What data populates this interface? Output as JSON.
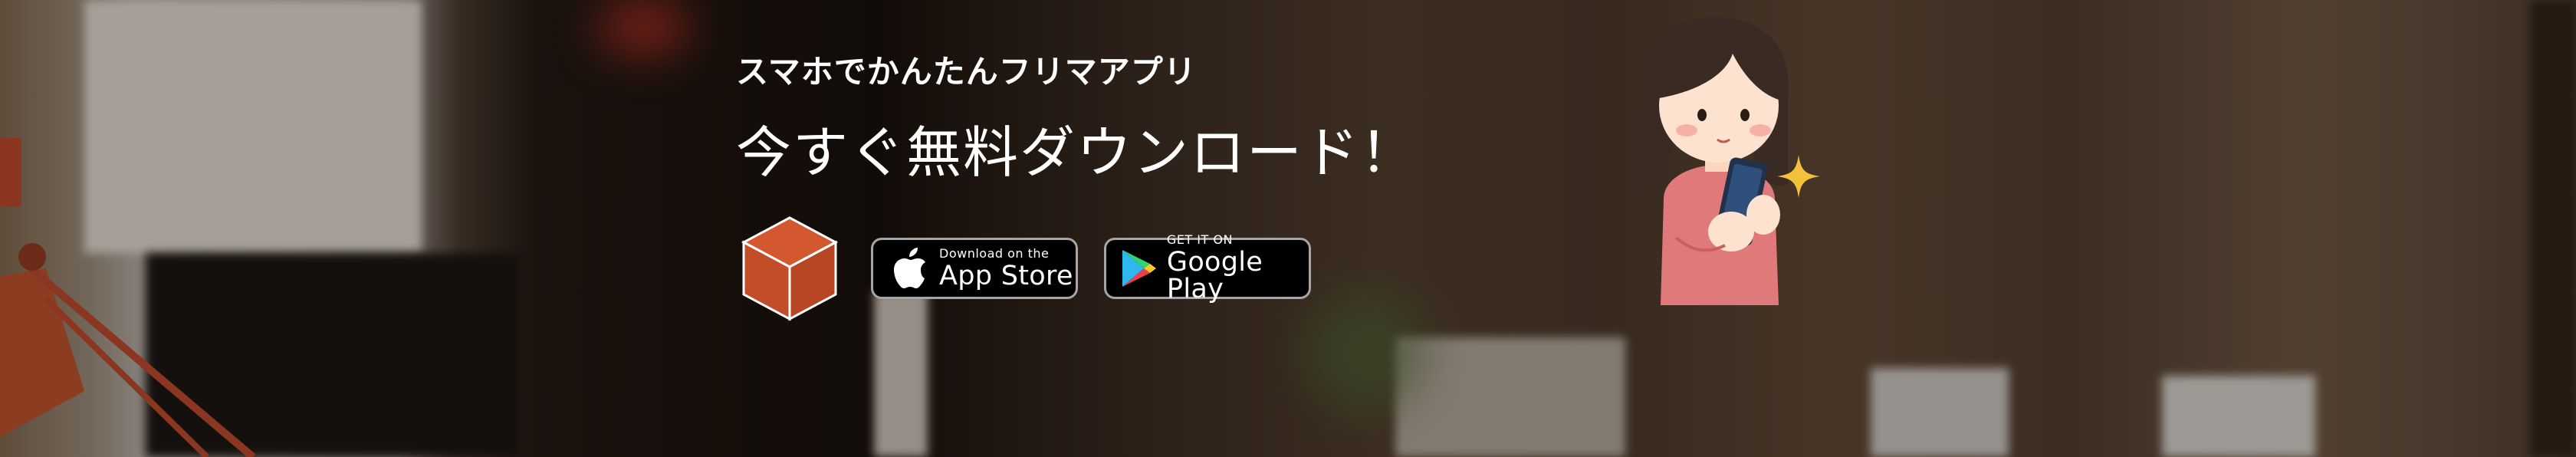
{
  "banner": {
    "tagline": "スマホでかんたんフリマアプリ",
    "headline": "今すぐ無料ダウンロード！"
  },
  "icons": {
    "app_logo": "box-cube-logo",
    "apple": "apple-icon",
    "google_play": "google-play-icon",
    "illustration": "girl-with-smartphone-illustration",
    "sparkle": "sparkle-icon"
  },
  "stores": {
    "app_store": {
      "small": "Download on the",
      "big": "App Store"
    },
    "google_play": {
      "small": "GET IT ON",
      "big": "Google Play"
    }
  },
  "colors": {
    "accent": "#d4582f",
    "button_bg": "#000000",
    "text": "#ffffff",
    "sparkle": "#f4c23a"
  }
}
